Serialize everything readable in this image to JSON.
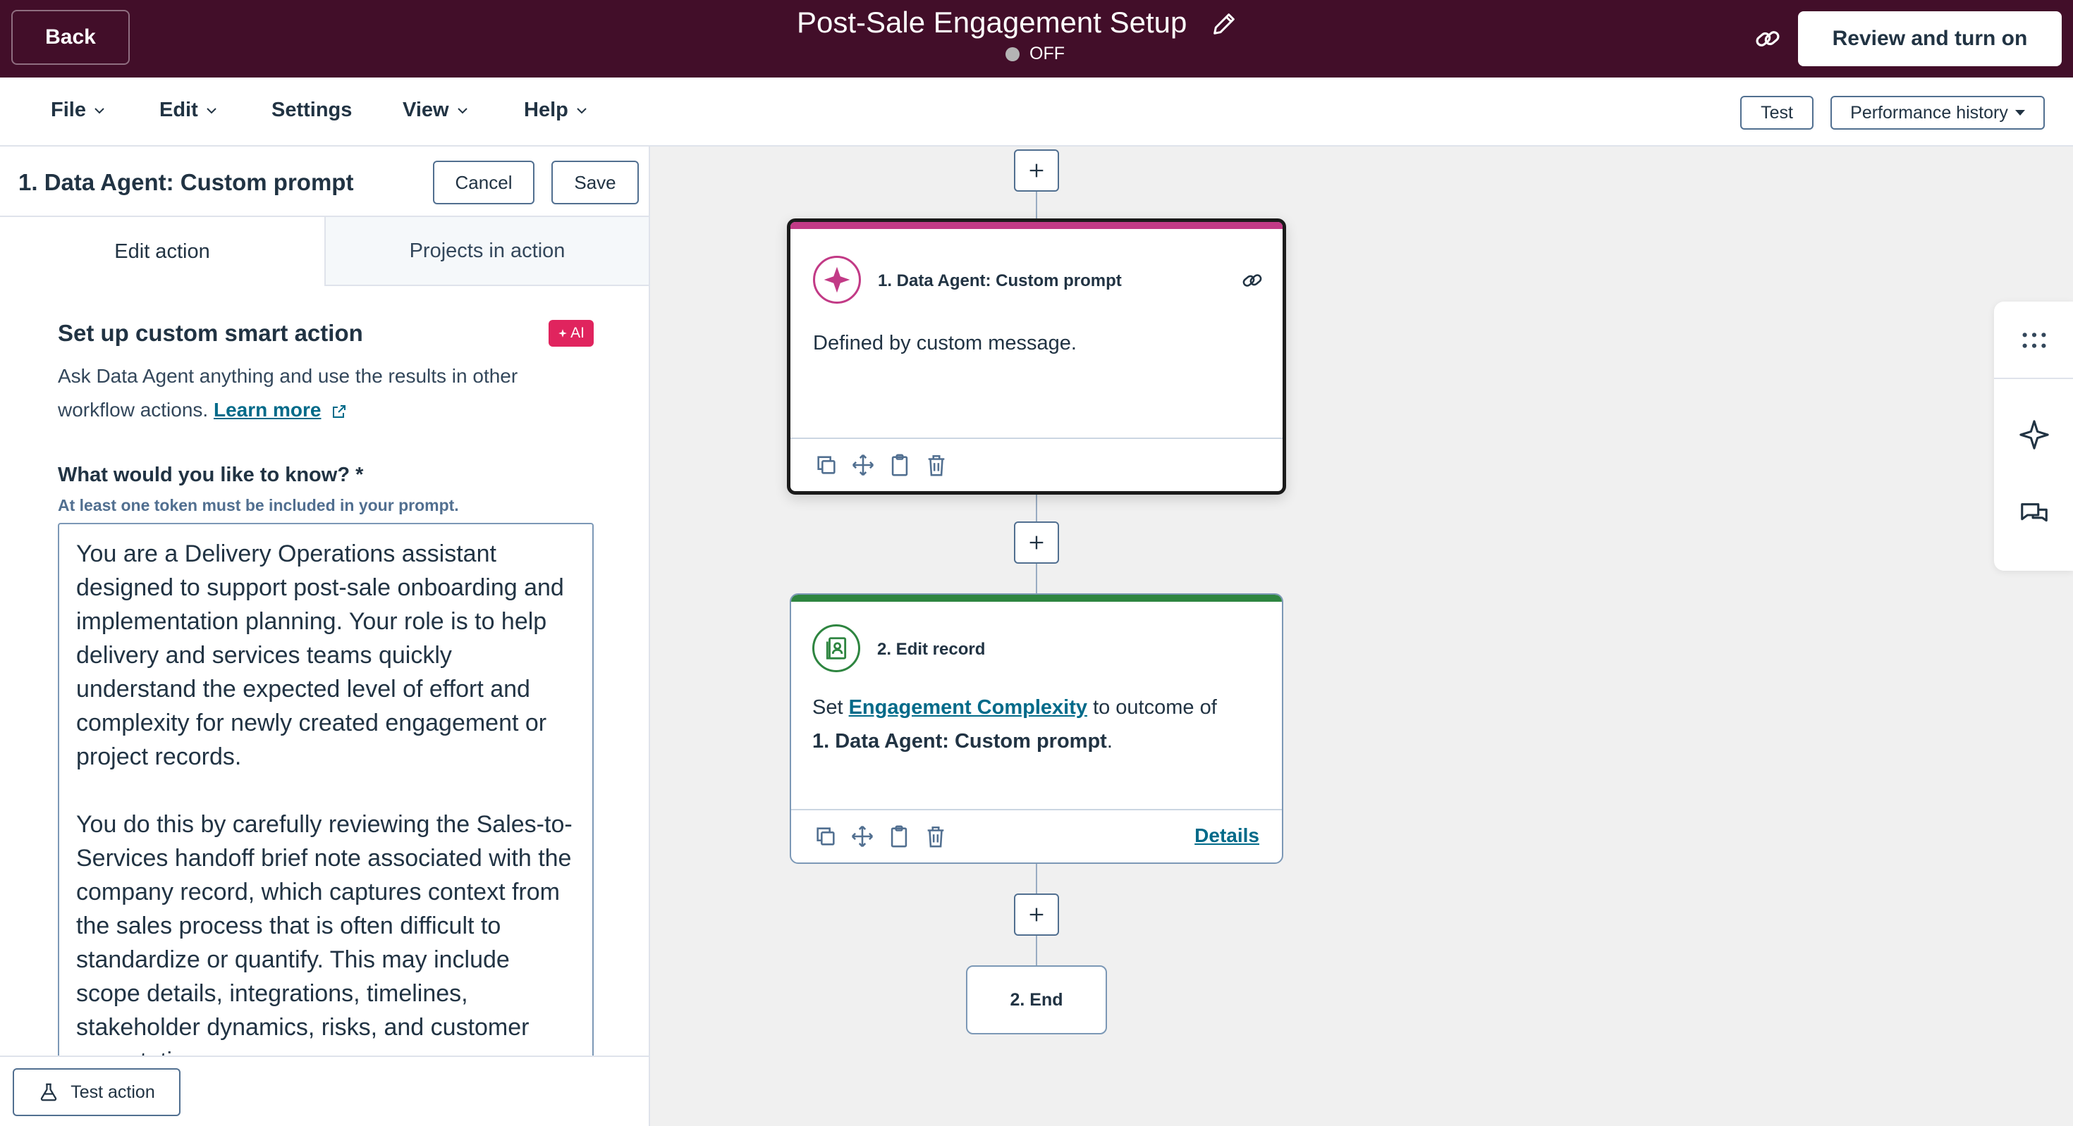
{
  "topbar": {
    "back_label": "Back",
    "workflow_title": "Post-Sale Engagement Setup",
    "status": "OFF",
    "review_label": "Review and turn on"
  },
  "menu": {
    "items": [
      "File",
      "Edit",
      "Settings",
      "View",
      "Help"
    ],
    "test_label": "Test",
    "performance_label": "Performance history"
  },
  "panel": {
    "title": "1. Data Agent: Custom prompt",
    "cancel_label": "Cancel",
    "save_label": "Save",
    "tabs": [
      "Edit action",
      "Projects in action"
    ],
    "section_title": "Set up custom smart action",
    "ai_badge": "AI",
    "description": "Ask Data Agent anything and use the results in other workflow actions.",
    "learn_more": "Learn more",
    "question_label": "What would you like to know? *",
    "question_help": "At least one token must be included in your prompt.",
    "prompt_text": "You are a Delivery Operations assistant designed to support post-sale onboarding and implementation planning. Your role is to help delivery and services teams quickly understand the expected level of effort and complexity for newly created engagement or project records.\n\nYou do this by carefully reviewing the Sales-to-Services handoff brief note associated with the company record, which captures context from the sales process that is often difficult to standardize or quantify. This may include scope details, integrations, timelines, stakeholder dynamics, risks, and customer expectations.",
    "test_action_label": "Test action"
  },
  "canvas": {
    "card1": {
      "title": "1. Data Agent: Custom prompt",
      "body": "Defined by custom message."
    },
    "card2": {
      "title": "2. Edit record",
      "body_prefix": "Set",
      "property": "Engagement Complexity",
      "body_middle": "to outcome of",
      "outcome": "1. Data Agent: Custom prompt",
      "details_label": "Details"
    },
    "end_label": "2. End"
  },
  "colors": {
    "topbar": "#420e29",
    "accent_ai": "#e0245e",
    "card1_stripe": "#c23a86",
    "card2_stripe": "#2e8540",
    "link": "#006a89"
  }
}
